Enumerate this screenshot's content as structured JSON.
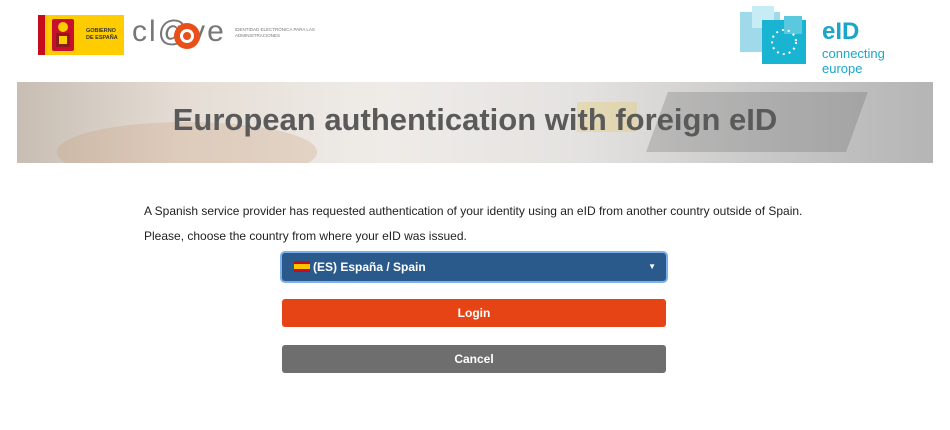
{
  "header": {
    "gob_logo": {
      "text": "GOBIERNO DE ESPAÑA",
      "icon": "spain-coat-of-arms-icon"
    },
    "clave_logo": {
      "word": "cl@ve",
      "subtitle": "IDENTIDAD ELECTRÓNICA PARA LAS ADMINISTRACIONES"
    },
    "eid_logo": {
      "title": "eID",
      "subtitle": "connecting europe",
      "icon": "eu-stars-squares-icon"
    }
  },
  "banner": {
    "title": "European authentication with foreign eID"
  },
  "main": {
    "intro": "A Spanish service provider has requested authentication of your identity using an eID from another country outside of Spain.",
    "choose": "Please, choose the country from where your eID was issued.",
    "country_select": {
      "value": "(ES) España / Spain",
      "flag": "spain-flag-icon"
    },
    "login_label": "Login",
    "cancel_label": "Cancel"
  },
  "colors": {
    "select_bg": "#2a5a8c",
    "login_bg": "#e64414",
    "cancel_bg": "#6e6e6e",
    "eid_accent": "#1aa6c9",
    "clave_accent": "#e8501a"
  }
}
